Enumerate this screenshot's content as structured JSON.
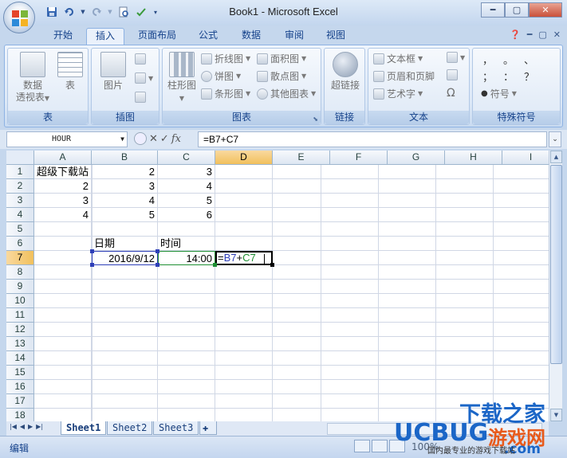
{
  "window": {
    "title": "Book1 - Microsoft Excel",
    "controls": {
      "minimize": "━",
      "restore": "▢",
      "close": "✕"
    }
  },
  "qat": [
    "save-icon",
    "undo-icon",
    "redo-icon",
    "print-preview-icon",
    "customize-icon"
  ],
  "tabs": [
    "开始",
    "插入",
    "页面布局",
    "公式",
    "数据",
    "审阅",
    "视图"
  ],
  "active_tab": "插入",
  "ribbon": {
    "groups": {
      "tables": {
        "label": "表",
        "pivot_line1": "数据",
        "pivot_line2": "透视表",
        "table": "表"
      },
      "illustrations": {
        "label": "插图",
        "picture": "图片"
      },
      "charts": {
        "label": "图表",
        "column": "柱形图",
        "line": "折线图",
        "pie": "饼图",
        "bar": "条形图",
        "area": "面积图",
        "scatter": "散点图",
        "other": "其他图表"
      },
      "links": {
        "label": "链接",
        "hyperlink": "超链接"
      },
      "text": {
        "label": "文本",
        "textbox": "文本框",
        "header_footer": "页眉和页脚",
        "wordart": "艺术字"
      },
      "symbols": {
        "label": "特殊符号",
        "symbol": "符号",
        "chars": [
          "，",
          "。",
          "、",
          "；",
          "：",
          "？"
        ]
      }
    }
  },
  "formula_bar": {
    "name_box": "HOUR",
    "formula": "=B7+C7",
    "cancel": "✕",
    "enter": "✓",
    "fx": "fx"
  },
  "columns": [
    "A",
    "B",
    "C",
    "D",
    "E",
    "F",
    "G",
    "H",
    "I"
  ],
  "selected_column": "D",
  "rows": [
    "1",
    "2",
    "3",
    "4",
    "5",
    "6",
    "7",
    "8",
    "9",
    "10",
    "11",
    "12",
    "13",
    "14",
    "15",
    "16",
    "17",
    "18"
  ],
  "selected_row": "7",
  "cells": {
    "A1": "超级下载站",
    "B1": "2",
    "C1": "3",
    "A2": "2",
    "B2": "3",
    "C2": "4",
    "A3": "3",
    "B3": "4",
    "C3": "5",
    "A4": "4",
    "B4": "5",
    "C4": "6",
    "B6": "日期",
    "C6": "时间",
    "B7": "2016/9/12",
    "C7": "14:00",
    "D7": "=B7+C7"
  },
  "sheet_tabs": [
    "Sheet1",
    "Sheet2",
    "Sheet3"
  ],
  "active_sheet": "Sheet1",
  "status": {
    "mode": "编辑",
    "zoom": "100%"
  },
  "watermark": {
    "brand": "UCBUG",
    "line1": "下载之家",
    "line2": "游戏网",
    "domain": ".com",
    "slogan": "国内最专业的游戏下载站"
  },
  "colors": {
    "ribbon_text": "#15428b",
    "selected_header": "#f1c05c",
    "ref_b7": "#2e3fb8",
    "ref_c7": "#1e8f33",
    "watermark_blue": "#1b66c7",
    "watermark_orange": "#e85a1b"
  }
}
